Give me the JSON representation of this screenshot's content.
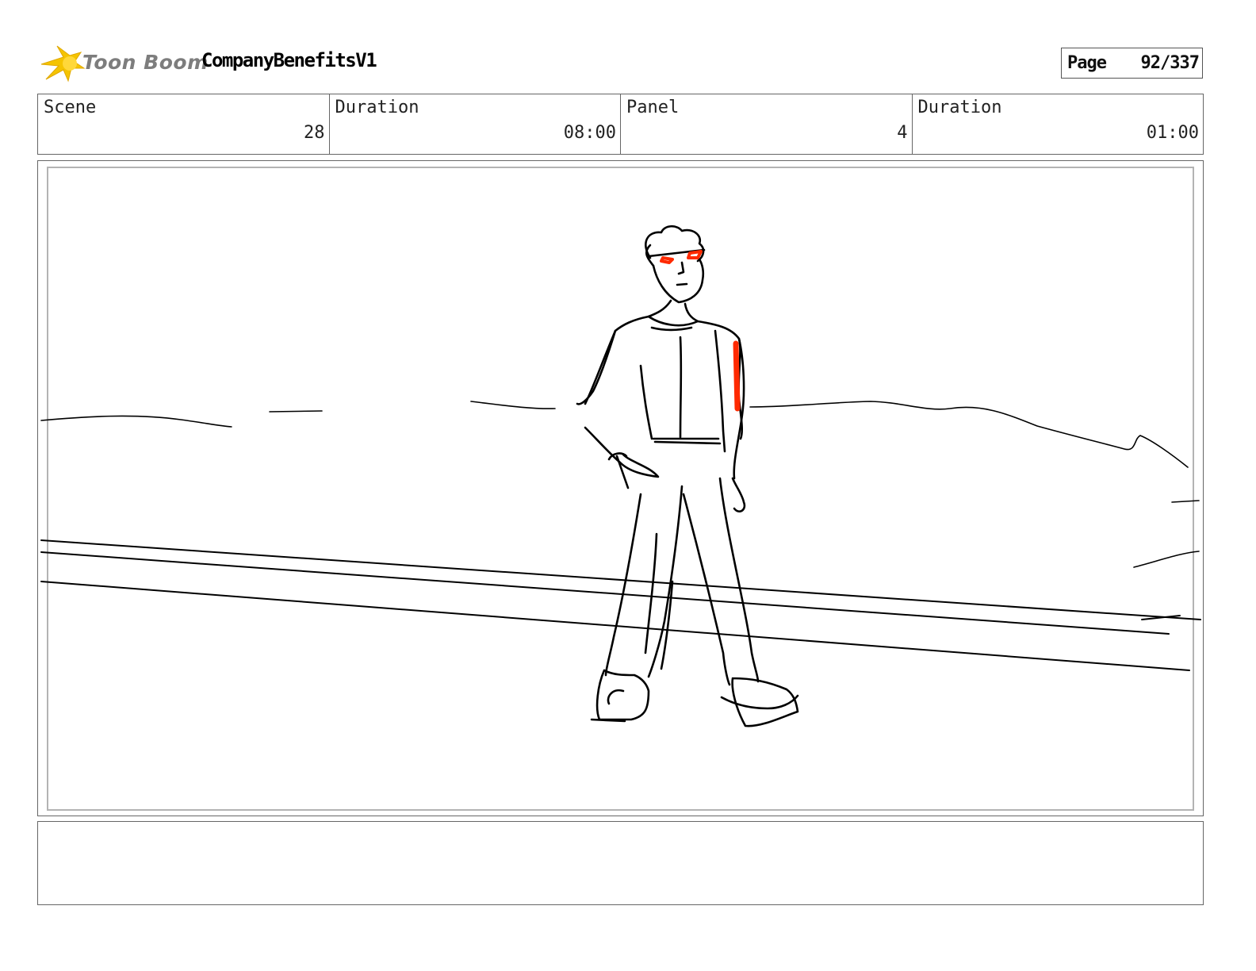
{
  "header": {
    "logo_text": "Toon Boom",
    "project_title": "CompanyBenefitsV1",
    "page_label": "Page",
    "page_value": "92/337"
  },
  "info": {
    "scene_label": "Scene",
    "scene_value": "28",
    "scene_duration_label": "Duration",
    "scene_duration_value": "08:00",
    "panel_label": "Panel",
    "panel_value": "4",
    "panel_duration_label": "Duration",
    "panel_duration_value": "01:00"
  },
  "panel": {
    "sketch_ink_color": "#000000",
    "accent_color": "#ff2a00",
    "content": "sketch-character-standing"
  },
  "notes": {
    "text": ""
  },
  "colors": {
    "logo_burst": "#f5c400",
    "logo_text": "#7d7d7d",
    "border": "#666666"
  }
}
